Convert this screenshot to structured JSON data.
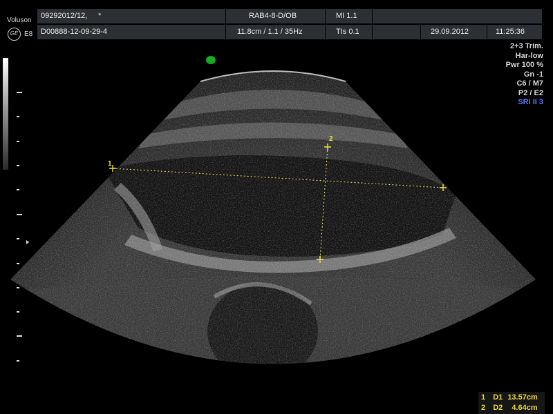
{
  "brand": {
    "name": "Voluson",
    "logo": "GE",
    "model": "E8"
  },
  "header": {
    "patient_id": "09292012/12,",
    "mark": "*",
    "probe": "RAB4-8-D/OB",
    "mi": "MI  1.1",
    "exam_id": "D00888-12-09-29-4",
    "imaging": "11.8cm / 1.1 / 35Hz",
    "tis": "TIs  0.1",
    "date": "29.09.2012",
    "time": "11:25:36"
  },
  "params": {
    "trim": "2+3 Trim.",
    "harmonic": "Har-low",
    "power": "Pwr 100 %",
    "gain": "Gn  -1",
    "c_m": "C6 / M7",
    "p_e": "P2 / E2",
    "sri": "SRI II 3"
  },
  "badge": "E8",
  "calipers": {
    "d1_label": "1",
    "d2_label": "2"
  },
  "measurements": [
    {
      "index": "1",
      "name": "D1",
      "value": "13.57cm"
    },
    {
      "index": "2",
      "name": "D2",
      "value": "4.64cm"
    }
  ],
  "colors": {
    "caliper": "#f2e24a",
    "header_bg": "#2c2f33",
    "sri": "#5a78ff",
    "badge": "#1aa51a"
  }
}
